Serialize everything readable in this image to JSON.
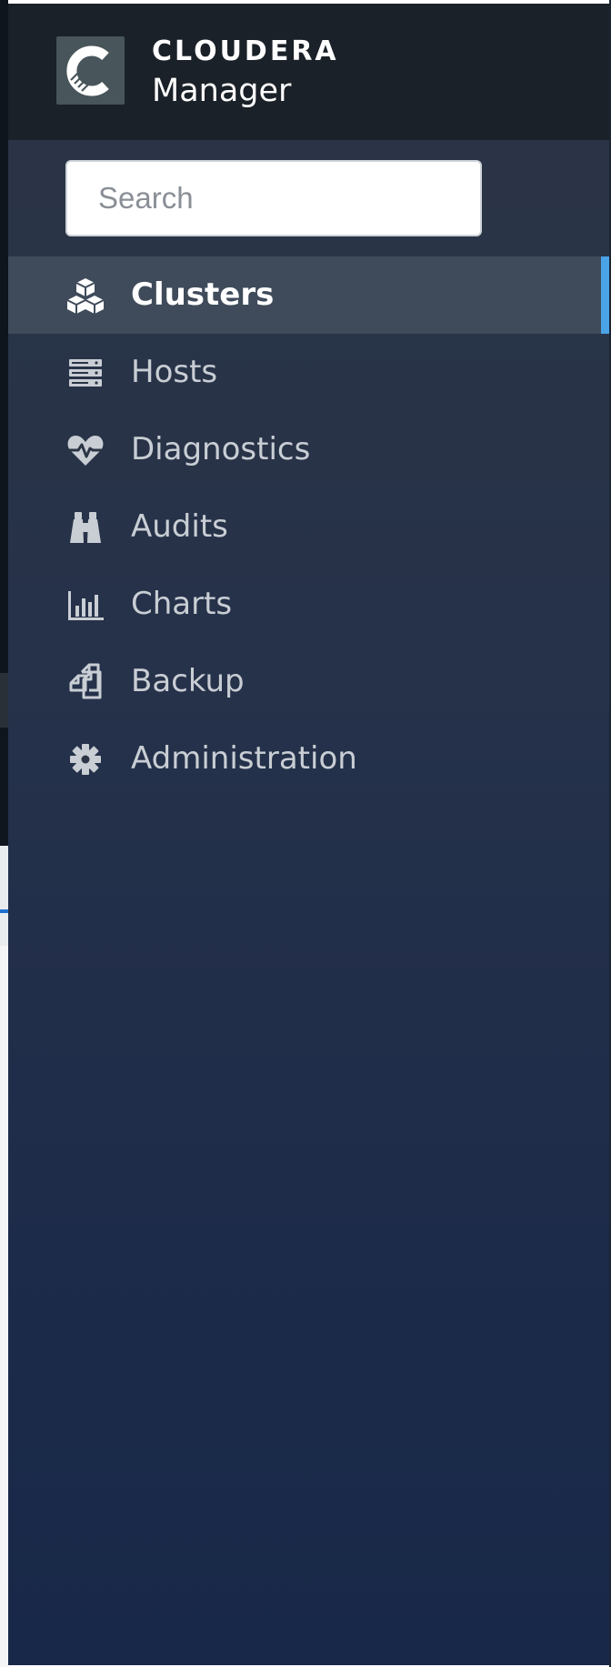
{
  "brand": {
    "name": "CLOUDERA",
    "product": "Manager"
  },
  "search": {
    "placeholder": "Search",
    "value": ""
  },
  "nav": {
    "items": [
      {
        "label": "Clusters",
        "icon": "cubes-icon",
        "active": true
      },
      {
        "label": "Hosts",
        "icon": "server-icon",
        "active": false
      },
      {
        "label": "Diagnostics",
        "icon": "heartbeat-icon",
        "active": false
      },
      {
        "label": "Audits",
        "icon": "binoculars-icon",
        "active": false
      },
      {
        "label": "Charts",
        "icon": "bar-chart-icon",
        "active": false
      },
      {
        "label": "Backup",
        "icon": "copy-icon",
        "active": false
      },
      {
        "label": "Administration",
        "icon": "gear-icon",
        "active": false
      }
    ]
  },
  "colors": {
    "accent": "#4ba3e8",
    "sidebar_top": "#2b3545",
    "sidebar_bottom": "#182848",
    "header_bg": "#1b2128",
    "active_item_bg": "#3f4b5a",
    "label_color": "#c9ced4"
  }
}
